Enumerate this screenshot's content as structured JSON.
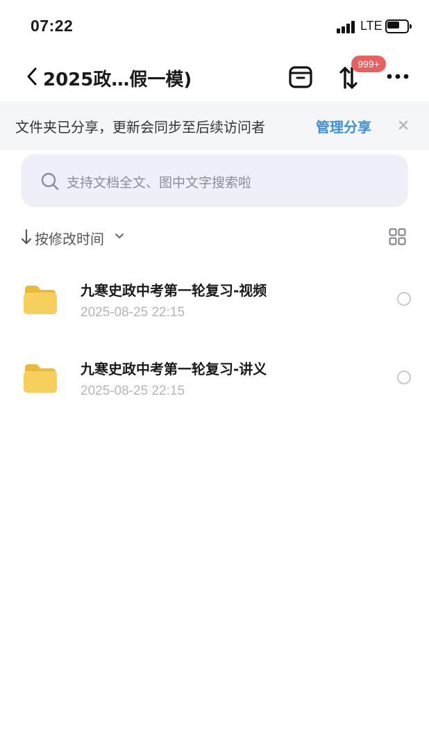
{
  "status_bar": {
    "time": "07:22",
    "network": "LTE",
    "signal_icon": "signal-bars-icon",
    "battery_icon": "battery-icon"
  },
  "nav": {
    "title": "2025政…假一模)",
    "back_icon": "chevron-left-icon",
    "box_icon": "archive-box-icon",
    "transfer_icon": "transfer-arrows-icon",
    "badge": "999+",
    "more_icon": "more-dots-icon"
  },
  "notice": {
    "text": "文件夹已分享，更新会同步至后续访问者",
    "action": "管理分享",
    "close_icon": "close-icon"
  },
  "search": {
    "placeholder": "支持文档全文、图中文字搜索啦",
    "icon": "search-icon"
  },
  "sort": {
    "label": "按修改时间",
    "arrow_icon": "arrow-down-icon",
    "chevron_icon": "chevron-down-icon",
    "view_icon": "grid-view-icon"
  },
  "files": [
    {
      "name": "九寒史政中考第一轮复习-视频",
      "time": "2025-08-25 22:15",
      "icon": "folder-icon"
    },
    {
      "name": "九寒史政中考第一轮复习-讲义",
      "time": "2025-08-25 22:15",
      "icon": "folder-icon"
    }
  ],
  "colors": {
    "accent": "#3b8fe0",
    "badge": "#e86060",
    "folder": "#f6cf5c",
    "notice_bg": "#f5f6f8",
    "search_bg": "#eef0f7"
  }
}
